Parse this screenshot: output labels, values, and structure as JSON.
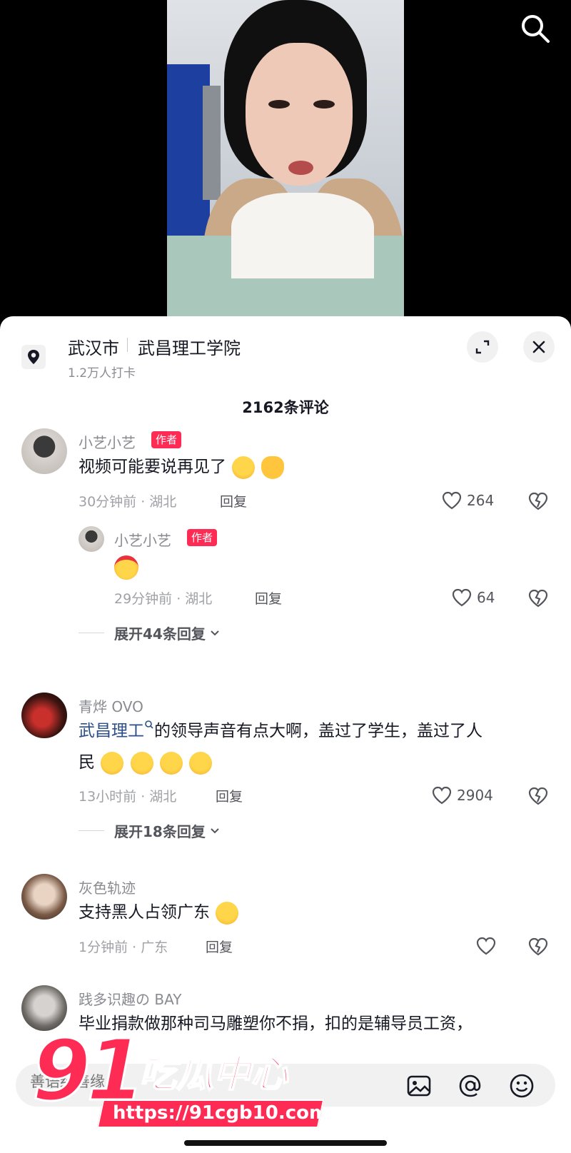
{
  "location": {
    "city": "武汉市",
    "school": "武昌理工学院",
    "checkins": "1.2万人打卡"
  },
  "comment_count": "2162条评论",
  "comments": [
    {
      "user": "小艺小艺",
      "badge": "作者",
      "text": "视频可能要说再见了",
      "meta": "30分钟前 · 湖北",
      "reply": "回复",
      "likes": "264",
      "replies": [
        {
          "user": "小艺小艺",
          "badge": "作者",
          "meta": "29分钟前 · 湖北",
          "reply": "回复",
          "likes": "64"
        }
      ],
      "expand": "展开44条回复"
    },
    {
      "user": "青烨 OVO",
      "mention": "武昌理工",
      "text_line1": "的领导声音有点大啊，盖过了学生，盖过了人",
      "text_line2": "民",
      "meta": "13小时前 · 湖北",
      "reply": "回复",
      "likes": "2904",
      "expand": "展开18条回复"
    },
    {
      "user": "灰色轨迹",
      "text": "支持黑人占领广东",
      "meta": "1分钟前 · 广东",
      "reply": "回复",
      "likes": ""
    },
    {
      "user": "践多识趣の BAY",
      "text": "毕业捐款做那种司马雕塑你不捐，扣的是辅导员工资，"
    }
  ],
  "input": {
    "placeholder": "善语结善缘"
  },
  "watermark": {
    "number": "91",
    "name": "吃瓜中心",
    "url": "https://91cgb10.com"
  },
  "colors": {
    "accent": "#fe2c55",
    "mention": "#2b4f8a",
    "muted": "#8a8b91"
  },
  "icons": [
    "search-icon",
    "location-pin-icon",
    "expand-icon",
    "close-icon",
    "heart-icon",
    "dislike-heart-icon",
    "chevron-down-icon",
    "image-icon",
    "at-icon",
    "emoji-icon"
  ]
}
